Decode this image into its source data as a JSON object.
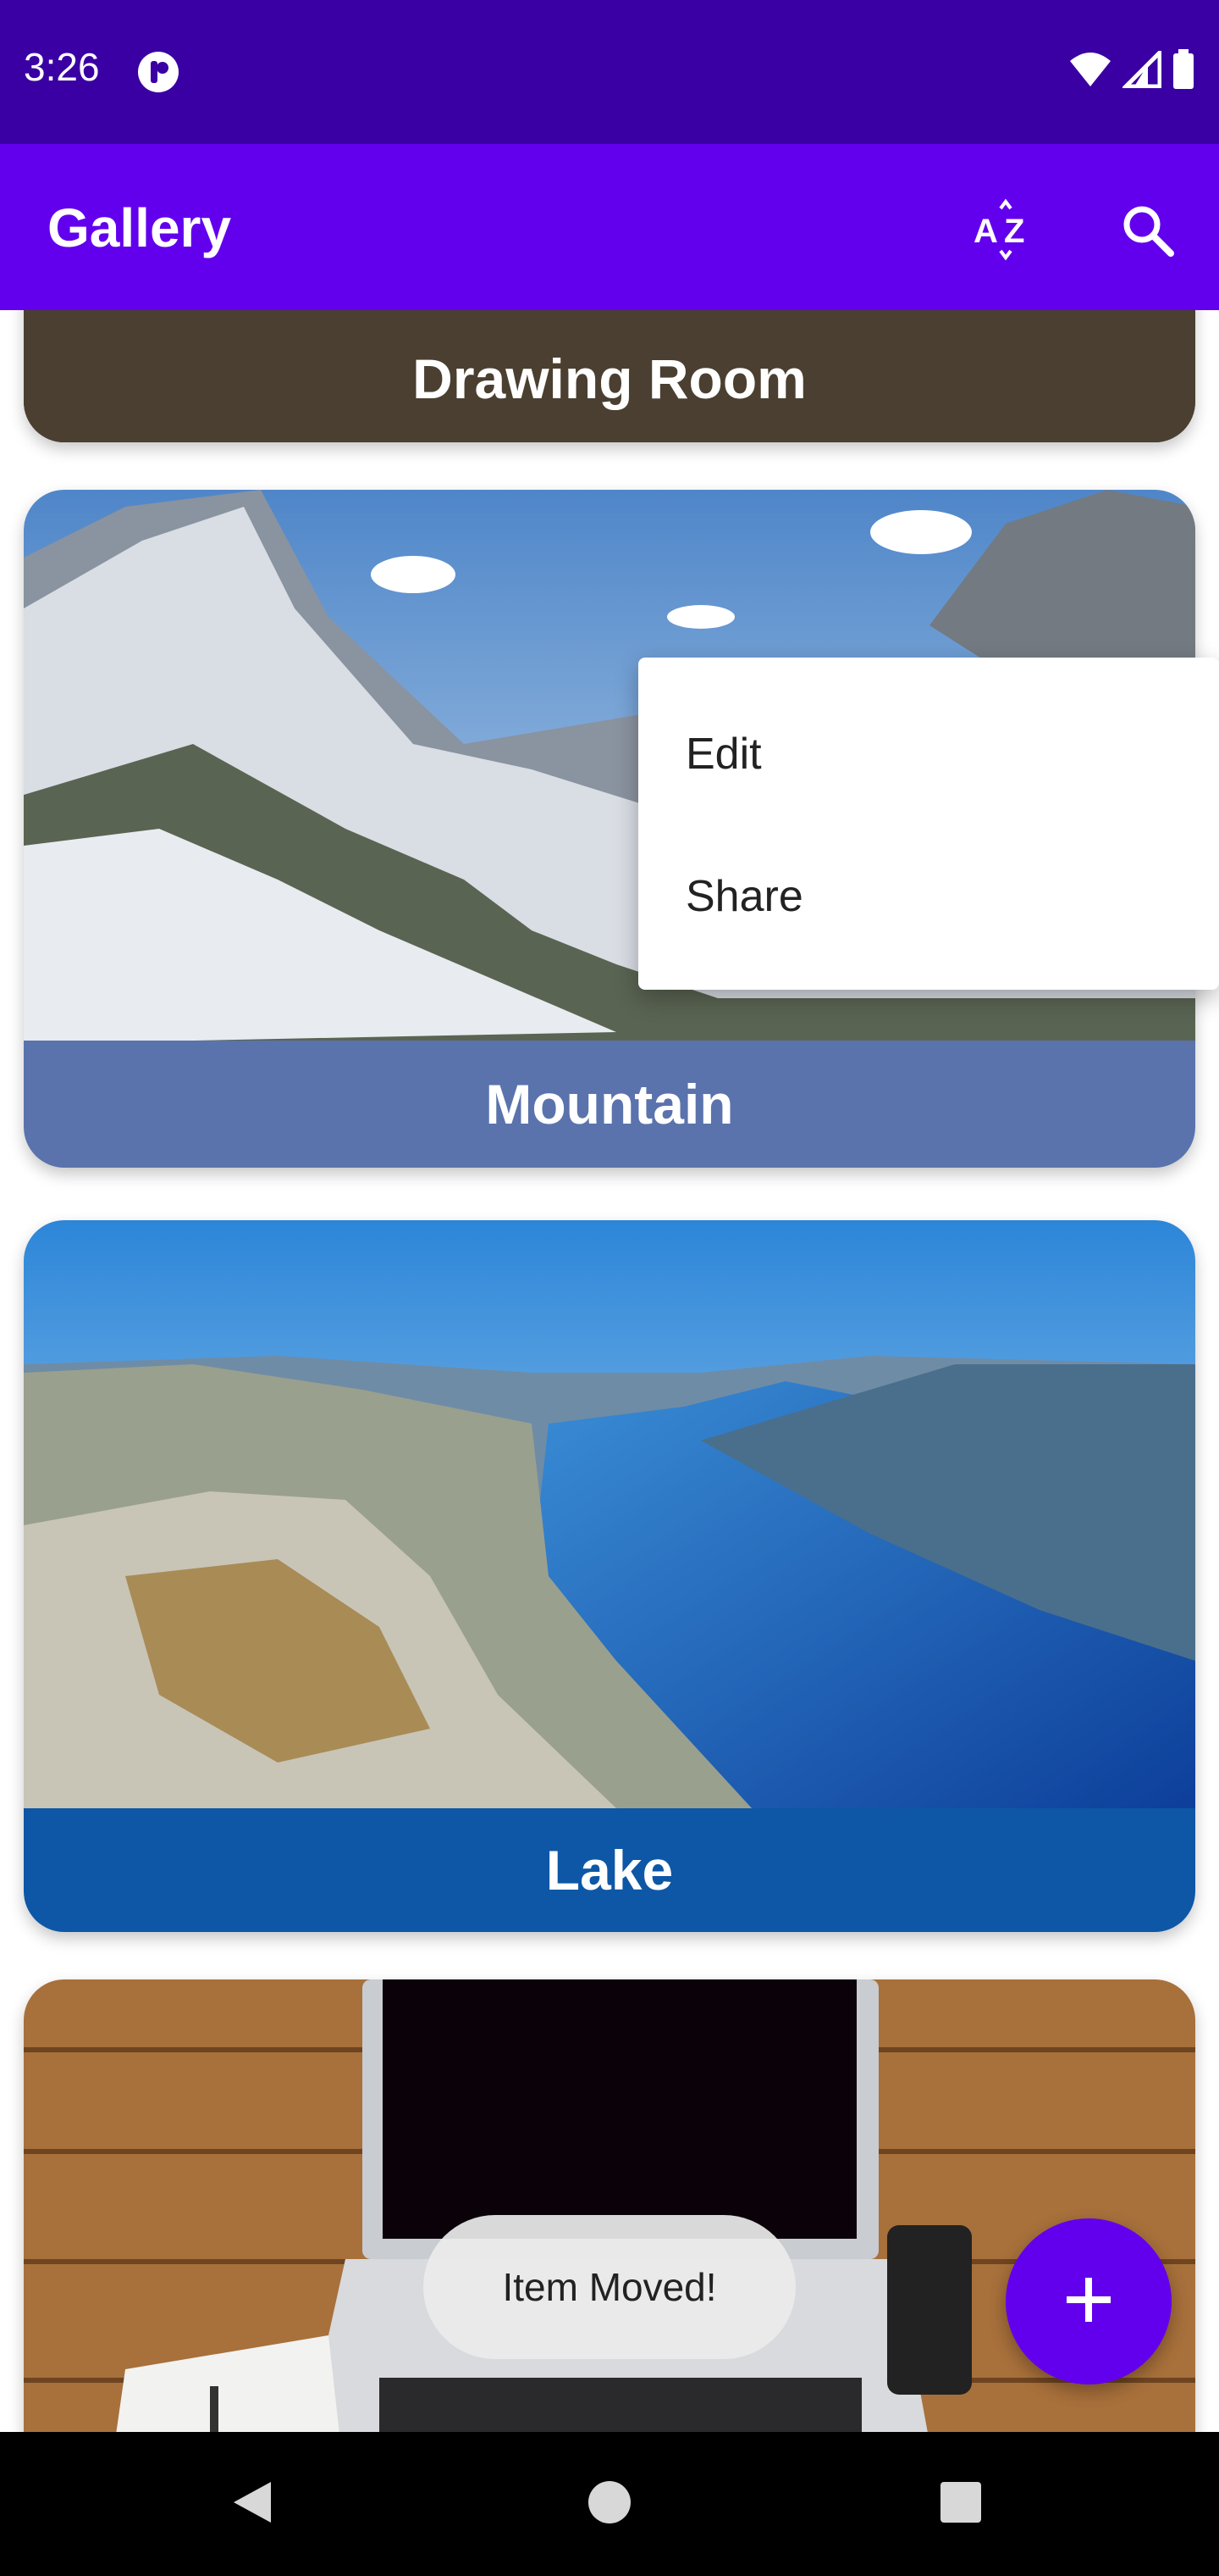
{
  "status_bar": {
    "time": "3:26",
    "icons": [
      "app-notification-icon",
      "wifi-icon",
      "signal-icon",
      "battery-icon"
    ]
  },
  "app_bar": {
    "title": "Gallery",
    "actions": [
      "sort-az-icon",
      "search-icon"
    ],
    "background": "#6200ee"
  },
  "cards": [
    {
      "caption": "Drawing Room",
      "caption_color": "#4a3f30"
    },
    {
      "caption": "Mountain",
      "caption_color": "#5a73ad"
    },
    {
      "caption": "Lake",
      "caption_color": "#0d57a6"
    },
    {
      "caption": "",
      "caption_color": ""
    }
  ],
  "popup_menu": {
    "items": [
      "Edit",
      "Share"
    ]
  },
  "toast": {
    "message": "Item Moved!"
  },
  "fab": {
    "icon": "plus-icon",
    "color": "#6200ee"
  },
  "nav_bar": {
    "buttons": [
      "back-icon",
      "home-icon",
      "recents-icon"
    ]
  }
}
